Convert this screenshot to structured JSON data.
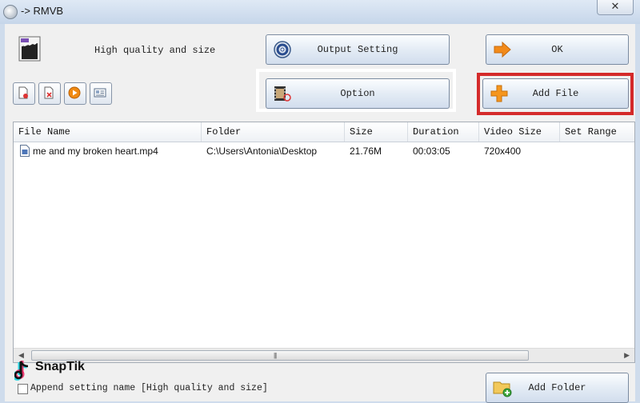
{
  "window": {
    "title": "-> RMVB",
    "close_symbol": "✕"
  },
  "preset": {
    "label": "High quality and size"
  },
  "buttons": {
    "output_setting": "Output Setting",
    "ok": "OK",
    "option": "Option",
    "add_file": "Add File",
    "add_folder": "Add Folder"
  },
  "file_list": {
    "columns": [
      "File Name",
      "Folder",
      "Size",
      "Duration",
      "Video Size",
      "Set Range"
    ],
    "rows": [
      {
        "file_name": "me and my broken heart.mp4",
        "folder": "C:\\Users\\Antonia\\Desktop",
        "size": "21.76M",
        "duration": "00:03:05",
        "video_size": "720x400",
        "set_range": ""
      }
    ]
  },
  "append": {
    "label": "Append setting name [High quality and size]",
    "checked": false
  },
  "watermark": {
    "text": "SnapTik"
  },
  "colors": {
    "highlight_red": "#d42a2a",
    "highlight_white": "#ffffff",
    "panel": "#f0f0f0"
  }
}
